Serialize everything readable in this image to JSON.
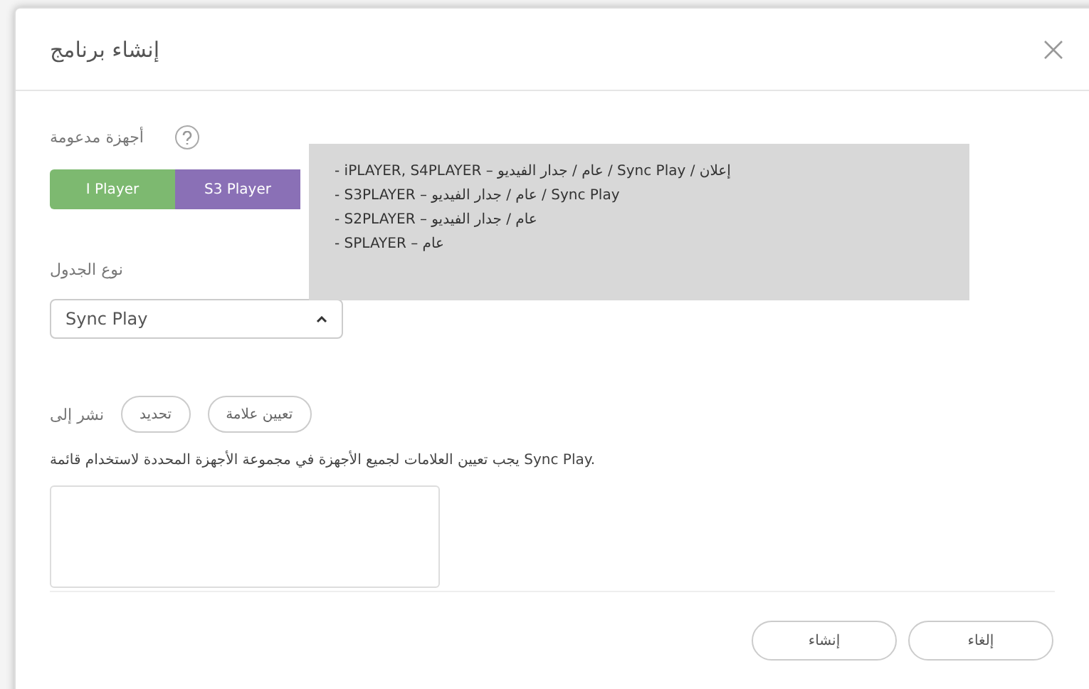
{
  "dialog": {
    "title": "إنشاء برنامج"
  },
  "supported_devices": {
    "label": "أجهزة مدعومة",
    "players": [
      {
        "label": "S3 Player",
        "color": "#8a70b6"
      },
      {
        "label": "I Player",
        "color": "#7db970"
      }
    ],
    "tooltip": [
      "- iPLAYER, S4PLAYER – عام / جدار الفيديو / Sync Play / إعلان",
      "- S3PLAYER – عام / جدار الفيديو / Sync Play",
      "- S2PLAYER – عام / جدار الفيديو",
      "- SPLAYER – عام"
    ]
  },
  "schedule_type": {
    "label": "نوع الجدول",
    "value": "Sync Play",
    "expanded": true
  },
  "publish_to": {
    "label": "نشر إلى",
    "buttons": [
      "تعيين علامة",
      "تحديد"
    ],
    "note": "يجب تعيين العلامات لجميع الأجهزة في مجموعة الأجهزة المحددة لاستخدام قائمة Sync Play."
  },
  "footer": {
    "buttons": [
      "إلغاء",
      "إنشاء"
    ]
  }
}
